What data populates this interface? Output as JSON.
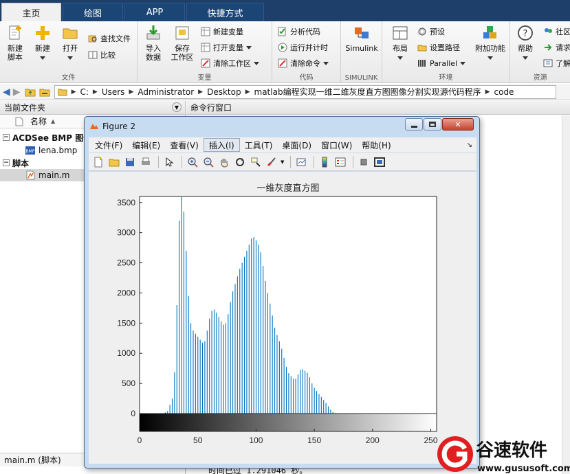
{
  "tabs": [
    {
      "label": "主页",
      "active": true
    },
    {
      "label": "绘图",
      "active": false
    },
    {
      "label": "APP",
      "active": false
    },
    {
      "label": "快捷方式",
      "active": false
    }
  ],
  "ribbon": {
    "file": {
      "label": "文件",
      "new_script": "新建\n脚本",
      "new": "新建",
      "open": "打开",
      "find_files": "查找文件",
      "compare": "比较"
    },
    "variable": {
      "label": "变量",
      "import_data": "导入\n数据",
      "save_workspace": "保存\n工作区",
      "new_variable": "新建变量",
      "open_variable": "打开变量",
      "clear_workspace": "清除工作区"
    },
    "code": {
      "label": "代码",
      "analyze_code": "分析代码",
      "run_and_time": "运行并计时",
      "clear_commands": "清除命令"
    },
    "simulink": {
      "label": "SIMULINK",
      "simulink": "Simulink"
    },
    "environment": {
      "label": "环境",
      "layout": "布局",
      "preferences": "预设",
      "set_path": "设置路径",
      "parallel": "Parallel",
      "addons": "附加功能"
    },
    "resources": {
      "label": "资源",
      "help": "帮助",
      "community": "社区",
      "request_support": "请求",
      "learn": "了解"
    }
  },
  "address": {
    "crumbs": [
      "C:",
      "Users",
      "Administrator",
      "Desktop",
      "matlab编程实现一维二维灰度直方图图像分割实现源代码程序",
      "code"
    ]
  },
  "left_panel": {
    "title": "当前文件夹",
    "column_name": "名称",
    "column_sort": "▲",
    "group_bmp": "ACDSee BMP 图像",
    "file_bmp": "lena.bmp",
    "group_script": "脚本",
    "file_script": "main.m",
    "status": "main.m (脚本)"
  },
  "command_window": {
    "title": "命令行窗口",
    "elapsed_line": "时间已过 1.291046 秒。"
  },
  "figure": {
    "window_title": "Figure 2",
    "menu": [
      "文件(F)",
      "编辑(E)",
      "查看(V)",
      "插入(I)",
      "工具(T)",
      "桌面(D)",
      "窗口(W)",
      "帮助(H)"
    ],
    "selected_menu_index": 3
  },
  "toolbar_icons": [
    "new-figure-icon",
    "open-file-icon",
    "save-icon",
    "print-icon",
    "select-arrow-icon",
    "zoom-in-icon",
    "zoom-out-icon",
    "pan-hand-icon",
    "rotate-3d-icon",
    "data-cursor-icon",
    "brush-icon",
    "link-plot-icon",
    "colorbar-icon",
    "legend-icon",
    "hide-plot-tools-icon",
    "show-plot-tools-icon"
  ],
  "chart_data": {
    "type": "bar",
    "title": "一维灰度直方图",
    "xlabel": "",
    "ylabel": "",
    "xlim": [
      0,
      255
    ],
    "ylim": [
      0,
      3600
    ],
    "xticks": [
      0,
      50,
      100,
      150,
      200,
      250
    ],
    "yticks": [
      0,
      500,
      1000,
      1500,
      2000,
      2500,
      3000,
      3500
    ],
    "color": "#0072bd",
    "bar_every": 2,
    "x": [
      0,
      10,
      20,
      24,
      28,
      31,
      33,
      35,
      37,
      39,
      41,
      43,
      45,
      47,
      49,
      51,
      53,
      55,
      57,
      59,
      61,
      63,
      65,
      67,
      69,
      71,
      73,
      75,
      77,
      79,
      81,
      83,
      85,
      87,
      89,
      91,
      93,
      95,
      97,
      99,
      101,
      103,
      105,
      107,
      109,
      111,
      113,
      115,
      117,
      119,
      121,
      123,
      125,
      127,
      129,
      131,
      133,
      135,
      137,
      139,
      141,
      143,
      145,
      147,
      149,
      151,
      153,
      155,
      157,
      159,
      161,
      163,
      165,
      167,
      169,
      171,
      173,
      175,
      177,
      179,
      181,
      183,
      185,
      187,
      189,
      191,
      193,
      195,
      197,
      199,
      201,
      203,
      205,
      207,
      209,
      211,
      213,
      215,
      217,
      219,
      221,
      225,
      230,
      240,
      255
    ],
    "y": [
      0,
      0,
      0,
      40,
      250,
      900,
      2700,
      3700,
      3600,
      3100,
      2300,
      1600,
      1400,
      1350,
      1300,
      1250,
      1200,
      1150,
      1250,
      1500,
      1650,
      1750,
      1700,
      1650,
      1550,
      1500,
      1450,
      1550,
      1750,
      1950,
      2100,
      2200,
      2350,
      2450,
      2550,
      2650,
      2750,
      2850,
      2950,
      2900,
      2850,
      2750,
      2600,
      2300,
      2100,
      1900,
      1750,
      1500,
      1350,
      1250,
      1150,
      1000,
      850,
      700,
      640,
      600,
      550,
      600,
      700,
      750,
      720,
      700,
      650,
      550,
      450,
      400,
      350,
      300,
      250,
      200,
      150,
      90,
      40,
      15,
      5,
      0,
      0,
      0,
      0,
      0,
      0,
      0,
      0,
      0,
      0,
      0,
      0,
      0,
      0,
      0,
      0,
      0,
      0,
      0,
      0,
      0,
      0,
      0,
      0,
      0,
      0,
      0,
      0,
      0,
      0,
      0
    ]
  }
}
